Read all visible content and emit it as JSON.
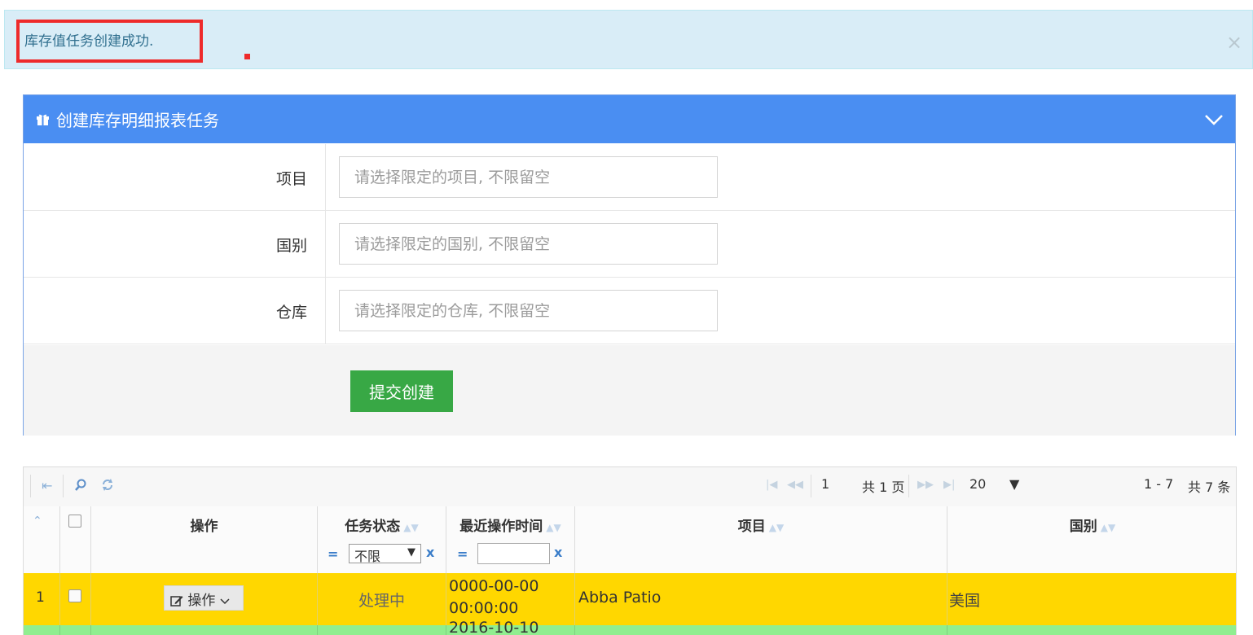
{
  "alert": {
    "message": "库存值任务创建成功.",
    "close_glyph": "×"
  },
  "panel": {
    "title": "创建库存明细报表任务",
    "icon": "gift-icon",
    "fields": [
      {
        "label": "项目",
        "placeholder": "请选择限定的项目, 不限留空"
      },
      {
        "label": "国别",
        "placeholder": "请选择限定的国别, 不限留空"
      },
      {
        "label": "仓库",
        "placeholder": "请选择限定的仓库, 不限留空"
      }
    ],
    "submit_label": "提交创建",
    "colors": {
      "header": "#4a8ef2",
      "submit": "#38a845"
    }
  },
  "grid": {
    "toolbar": {
      "page": "1",
      "total_pages": "共 1 页",
      "page_size": "20",
      "range": "1 - 7",
      "total": "共 7 条"
    },
    "columns": {
      "op": "操作",
      "status": "任务状态",
      "time": "最近操作时间",
      "project": "项目",
      "country": "国别"
    },
    "filters": {
      "eq": "=",
      "clear": "x",
      "status_value": "不限"
    },
    "rows": [
      {
        "num": "1",
        "op_label": "操作",
        "status": "处理中",
        "time": "0000-00-00 00:00:00",
        "project": "Abba Patio",
        "country": "美国",
        "color": "#ffd700"
      },
      {
        "num": "",
        "op_label": "",
        "status": "",
        "time": "2016-10-10",
        "project": "",
        "country": "",
        "color": "#90ee90"
      }
    ]
  }
}
